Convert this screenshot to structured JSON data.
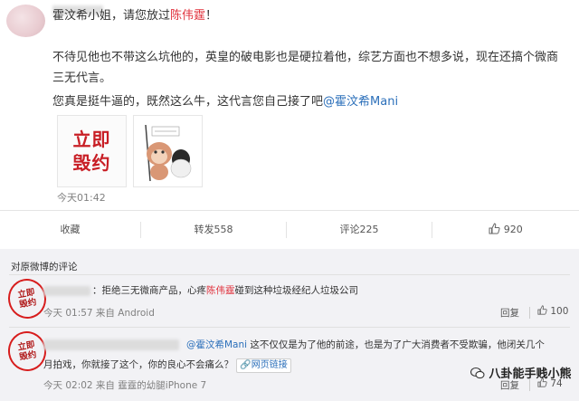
{
  "post": {
    "line1_a": "霍汶希小姐，请您放过",
    "line1_red": "陈伟霆",
    "line1_b": "！",
    "line2": "不待见他也不带这么坑他的，英皇的破电影也是硬拉着他，综艺方面也不想多说，现在还搞个微商",
    "line3": "三无代言。",
    "line4_a": "您真是挺牛逼的，既然这么牛，这代言您自己接了吧",
    "line4_mention": "@霍汶希Mani",
    "sticker_line1": "立即",
    "sticker_line2": "毁约",
    "time": "今天01:42"
  },
  "actions": {
    "favorite": "收藏",
    "repost": "转发558",
    "comment": "评论225",
    "like": "920"
  },
  "comments_section": {
    "header": "对原微博的评论",
    "items": [
      {
        "stamp_line1": "立即",
        "stamp_line2": "毁约",
        "text_a": "：拒绝三无微商产品，心疼",
        "text_red": "陈伟霆",
        "text_b": "碰到这种垃圾经纪人垃圾公司",
        "meta": "今天 01:57 来自 Android",
        "reply": "回复",
        "likes": "100"
      },
      {
        "stamp_line1": "立即",
        "stamp_line2": "毁约",
        "mention": "@霍汶希Mani",
        "text_a": " 这不仅仅是为了他的前途，也是为了广大消费者不受欺骗，他闭关几个",
        "text_b": "月拍戏，你就接了这个，你的良心不会痛么？",
        "link": "网页链接",
        "meta": "今天 02:02 来自 霆霆的幼腿iPhone 7",
        "reply": "回复",
        "likes": "74"
      }
    ]
  },
  "watermark": "八卦能手贱小熊"
}
